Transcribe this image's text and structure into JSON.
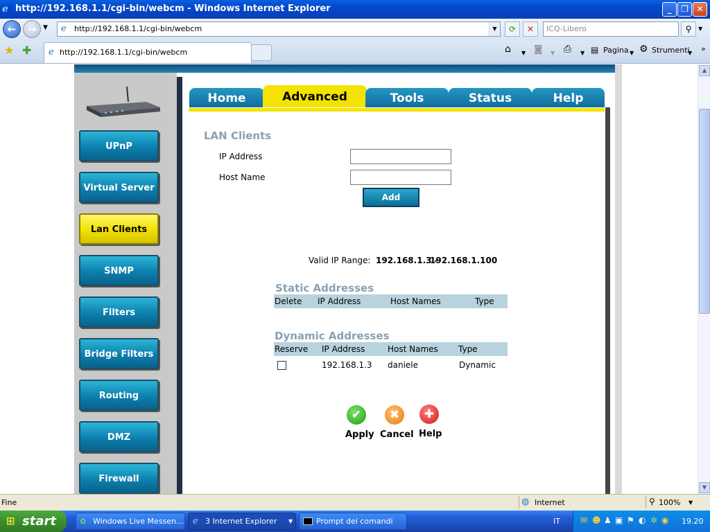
{
  "window": {
    "title": "http://192.168.1.1/cgi-bin/webcm - Windows Internet Explorer"
  },
  "address_bar": {
    "url": "http://192.168.1.1/cgi-bin/webcm",
    "search_placeholder": "ICQ-Libero"
  },
  "tab": {
    "label": "http://192.168.1.1/cgi-bin/webcm"
  },
  "toolbar": {
    "page_label": "Pagina",
    "tools_label": "Strumenti"
  },
  "router": {
    "top_tabs": [
      {
        "label": "Home"
      },
      {
        "label": "Advanced"
      },
      {
        "label": "Tools"
      },
      {
        "label": "Status"
      },
      {
        "label": "Help"
      }
    ],
    "sidebar": [
      {
        "label": "UPnP"
      },
      {
        "label": "Virtual Server"
      },
      {
        "label": "Lan Clients"
      },
      {
        "label": "SNMP"
      },
      {
        "label": "Filters"
      },
      {
        "label": "Bridge Filters"
      },
      {
        "label": "Routing"
      },
      {
        "label": "DMZ"
      },
      {
        "label": "Firewall"
      }
    ],
    "lan_clients": {
      "title": "LAN Clients",
      "ip_label": "IP Address",
      "host_label": "Host Name",
      "ip_value": "",
      "host_value": "",
      "add_label": "Add",
      "range_label": "Valid IP Range:",
      "range_start": "192.168.1.3 -",
      "range_end": "192.168.1.100"
    },
    "static": {
      "title": "Static Addresses",
      "columns": [
        "Delete",
        "IP Address",
        "Host Names",
        "Type"
      ]
    },
    "dynamic": {
      "title": "Dynamic Addresses",
      "columns": [
        "Reserve",
        "IP Address",
        "Host Names",
        "Type"
      ],
      "rows": [
        {
          "ip": "192.168.1.3",
          "host": "daniele",
          "type": "Dynamic"
        }
      ]
    },
    "actions": {
      "apply": "Apply",
      "cancel": "Cancel",
      "help": "Help"
    }
  },
  "status_bar": {
    "text": "Fine",
    "zone": "Internet",
    "zoom": "100%"
  },
  "taskbar": {
    "start": "start",
    "tasks": [
      {
        "label": "Windows Live Messen..."
      },
      {
        "label": "3 Internet Explorer"
      },
      {
        "label": "Prompt dei comandi"
      }
    ],
    "lang": "IT",
    "clock": "19.20"
  },
  "colors": {
    "router_tab_blue": "#1a82b3",
    "router_active_yellow": "#f4e300",
    "section_header": "#8aa1b3"
  }
}
